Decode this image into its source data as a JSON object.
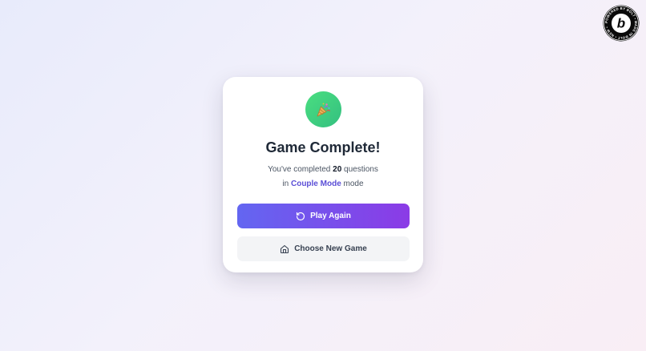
{
  "badge": {
    "letter": "b",
    "ring_text": "POWERED BY BOLT • MADE IN BOLT • NEW • "
  },
  "card": {
    "icon": "party-popper-icon",
    "title": "Game Complete!",
    "summary": {
      "prefix": "You've completed ",
      "count": "20",
      "suffix": " questions",
      "mode_prefix": "in ",
      "mode_name": "Couple Mode",
      "mode_suffix": " mode"
    },
    "play_again_label": "Play Again",
    "choose_new_game_label": "Choose New Game"
  },
  "colors": {
    "success": "#4ade80",
    "primary_start": "#6366f1",
    "primary_end": "#8b3be6",
    "mode_accent": "#5b4fd6"
  }
}
